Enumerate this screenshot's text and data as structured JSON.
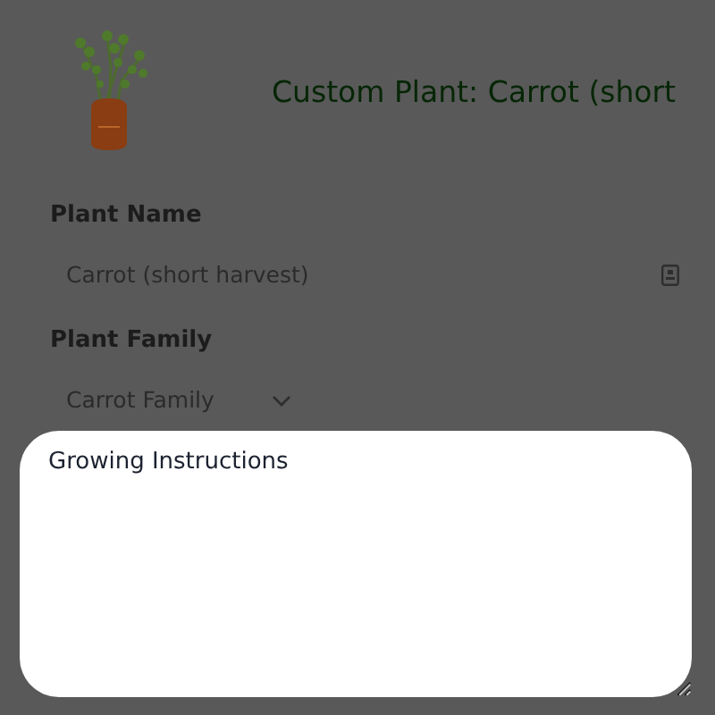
{
  "header": {
    "title": "Custom Plant: Carrot (short"
  },
  "fields": [
    {
      "kind": "text",
      "label": "Plant Name",
      "value": "Carrot (short harvest)"
    },
    {
      "kind": "select",
      "label": "Plant Family",
      "value": "Carrot Family"
    }
  ],
  "instructions": {
    "placeholder": "Growing Instructions"
  }
}
